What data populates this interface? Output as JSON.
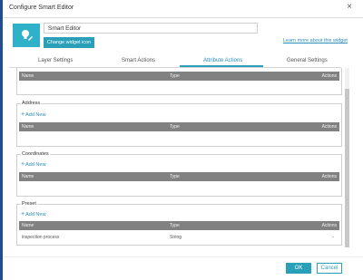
{
  "dialog": {
    "title": "Configure Smart Editor",
    "close_symbol": "×"
  },
  "widget": {
    "icon": "lightbulb-pencil-icon",
    "name_value": "Smart Editor",
    "change_icon_label": "Change widget icon",
    "learn_more_label": "Learn more about this widget"
  },
  "tabs": [
    {
      "label": "Layer Settings",
      "active": false
    },
    {
      "label": "Smart Actions",
      "active": false
    },
    {
      "label": "Attribute Actions",
      "active": true
    },
    {
      "label": "General Settings",
      "active": false
    }
  ],
  "table_headers": {
    "name": "Name",
    "type": "Type",
    "actions": "Actions"
  },
  "add_new_label": "Add New",
  "sections": {
    "address": {
      "label": "Address"
    },
    "coordinates": {
      "label": "Coordinates"
    },
    "preset": {
      "label": "Preset",
      "rows": [
        {
          "name": "inspection process",
          "type": "String",
          "actions": "-"
        }
      ]
    }
  },
  "footer": {
    "ok_label": "OK",
    "cancel_label": "Cancel"
  },
  "colors": {
    "accent": "#2a9fb8",
    "table_header": "#818181",
    "window_edge": "#1f4e8c"
  }
}
